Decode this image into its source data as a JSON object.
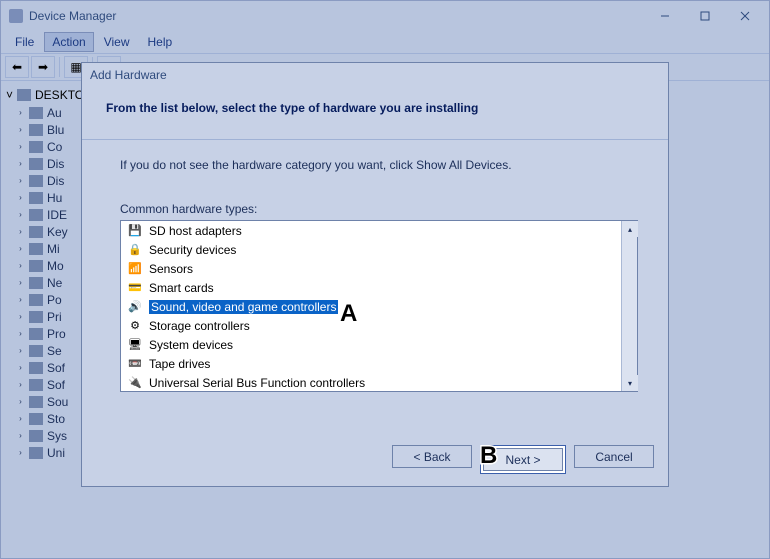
{
  "window": {
    "title": "Device Manager",
    "menu": [
      "File",
      "Action",
      "View",
      "Help"
    ],
    "menu_active_index": 1
  },
  "tree": {
    "root": "DESKTOP",
    "nodes": [
      "Audio",
      "Bluetooth",
      "Computer",
      "Disk drives",
      "Display adapters",
      "Human Interface",
      "IDE ATA/ATAPI",
      "Keyboards",
      "Mice and other",
      "Monitors",
      "Network adapters",
      "Portable devices",
      "Print queues",
      "Processors",
      "Security devices",
      "Software components",
      "Software devices",
      "Sound, video",
      "Storage controllers",
      "System devices",
      "Universal Serial"
    ],
    "display": [
      "Au",
      "Blu",
      "Co",
      "Dis",
      "Dis",
      "Hu",
      "IDE",
      "Key",
      "Mi",
      "Mo",
      "Ne",
      "Po",
      "Pri",
      "Pro",
      "Se",
      "Sof",
      "Sof",
      "Sou",
      "Sto",
      "Sys",
      "Uni"
    ]
  },
  "dialog": {
    "title": "Add Hardware",
    "heading": "From the list below, select the type of hardware you are installing",
    "hint": "If you do not see the hardware category you want, click Show All Devices.",
    "list_label": "Common hardware types:",
    "items": [
      {
        "label": "SD host adapters",
        "icon": "💾"
      },
      {
        "label": "Security devices",
        "icon": "🔒"
      },
      {
        "label": "Sensors",
        "icon": "📶"
      },
      {
        "label": "Smart cards",
        "icon": "💳"
      },
      {
        "label": "Sound, video and game controllers",
        "icon": "🔊",
        "selected": true
      },
      {
        "label": "Storage controllers",
        "icon": "⚙"
      },
      {
        "label": "System devices",
        "icon": "🖥"
      },
      {
        "label": "Tape drives",
        "icon": "📼"
      },
      {
        "label": "Universal Serial Bus Function controllers",
        "icon": "🔌"
      }
    ],
    "buttons": {
      "back": "< Back",
      "next": "Next >",
      "cancel": "Cancel"
    }
  },
  "annotations": {
    "a": "A",
    "b": "B"
  }
}
